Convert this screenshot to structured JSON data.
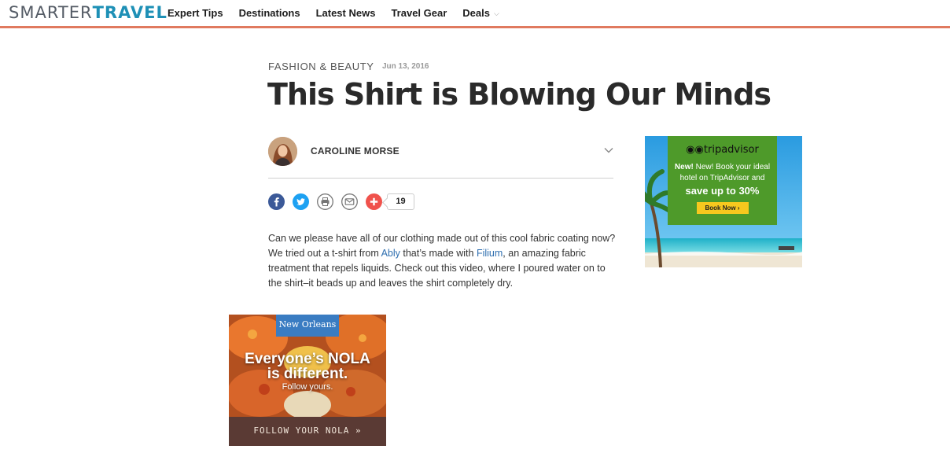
{
  "header": {
    "logo_part1": "SMARTER",
    "logo_part2": "TRAVEL",
    "nav": [
      {
        "label": "Expert Tips"
      },
      {
        "label": "Destinations"
      },
      {
        "label": "Latest News"
      },
      {
        "label": "Travel Gear"
      },
      {
        "label": "Deals",
        "has_dropdown": true
      }
    ],
    "accent_color": "#e07a5f"
  },
  "article": {
    "category": "FASHION & BEAUTY",
    "date": "Jun 13, 2016",
    "title": "This Shirt is Blowing Our Minds",
    "author": "CAROLINE MORSE",
    "share": {
      "icons": [
        "facebook-icon",
        "twitter-icon",
        "print-icon",
        "email-icon",
        "plus-icon"
      ],
      "count": "19"
    },
    "body": {
      "p1": "Can we please have all of our clothing made out of this cool fabric coating now? We tried out a t-shirt from ",
      "link1": "Ably",
      "p2": " that’s made with ",
      "link2": "Filium",
      "p3": ", an amazing fabric treatment that repels liquids. Check out this video, where I poured water on to the shirt–it beads up and leaves the shirt completely dry."
    }
  },
  "ads": {
    "tripadvisor": {
      "brand": "tripadvisor",
      "line1": "New! Book your ideal",
      "line2": "hotel on TripAdvisor and",
      "line3": "save up to 30%",
      "cta": "Book Now ›"
    },
    "nola": {
      "badge": "New Orleans",
      "headline1": "Everyone’s NOLA",
      "headline2": "is different.",
      "subline": "Follow yours.",
      "footer": "FOLLOW YOUR NOLA »"
    }
  }
}
